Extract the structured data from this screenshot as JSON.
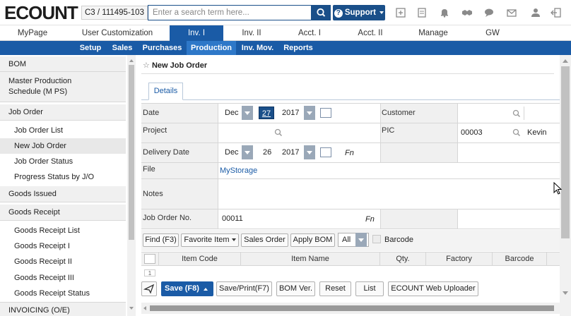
{
  "app": {
    "logo": "ECOUNT",
    "company": "C3 / 111495-103",
    "search_placeholder": "Enter a search term here...",
    "support_label": "Support"
  },
  "top_icons": [
    "new-window-icon",
    "document-icon",
    "bell-icon",
    "handshake-icon",
    "chat-icon",
    "mail-icon",
    "user-icon",
    "logout-icon"
  ],
  "menu": {
    "tabs": [
      "MyPage",
      "User Customization",
      "Inv. I",
      "Inv. II",
      "Acct. I",
      "Acct. II",
      "Manage",
      "GW"
    ],
    "active": "Inv. I"
  },
  "submenu": {
    "tabs": [
      "Setup",
      "Sales",
      "Purchases",
      "Production",
      "Inv. Mov.",
      "Reports"
    ],
    "active": "Production"
  },
  "sidebar": {
    "bom": "BOM",
    "mps": "Master Production Schedule (M PS)",
    "job_order": "Job Order",
    "job_order_items": [
      "Job Order List",
      "New Job Order",
      "Job Order Status",
      "Progress Status by J/O"
    ],
    "goods_issued": "Goods Issued",
    "goods_receipt": "Goods Receipt",
    "goods_receipt_items": [
      "Goods Receipt List",
      "Goods Receipt I",
      "Goods Receipt II",
      "Goods Receipt III",
      "Goods Receipt Status"
    ],
    "invoicing": "INVOICING (O/E)"
  },
  "page": {
    "title": "New Job Order",
    "tab": "Details"
  },
  "form": {
    "date_label": "Date",
    "date_month": "Dec",
    "date_day": "27",
    "date_year": "2017",
    "customer_label": "Customer",
    "project_label": "Project",
    "pic_label": "PIC",
    "pic_code": "00003",
    "pic_name": "Kevin",
    "delivery_label": "Delivery Date",
    "delivery_month": "Dec",
    "delivery_day": "26",
    "delivery_year": "2017",
    "fn": "Fn",
    "file_label": "File",
    "file_link": "MyStorage",
    "notes_label": "Notes",
    "jo_no_label": "Job Order No.",
    "jo_no": "00011"
  },
  "toolbar": {
    "find": "Find (F3)",
    "favorite": "Favorite Item",
    "sales_order": "Sales Order",
    "apply_bom": "Apply BOM",
    "all": "All",
    "barcode": "Barcode"
  },
  "table": {
    "columns": [
      "Item Code",
      "Item Name",
      "Qty.",
      "Factory",
      "Barcode"
    ],
    "first_row": "1"
  },
  "footer": {
    "save": "Save (F8)",
    "save_print": "Save/Print(F7)",
    "bom_ver": "BOM Ver.",
    "reset": "Reset",
    "list": "List",
    "uploader": "ECOUNT Web Uploader"
  },
  "colors": {
    "primary": "#1a5ba6",
    "dark_blue": "#1a4f89",
    "label_bg": "#f0f0f0"
  }
}
